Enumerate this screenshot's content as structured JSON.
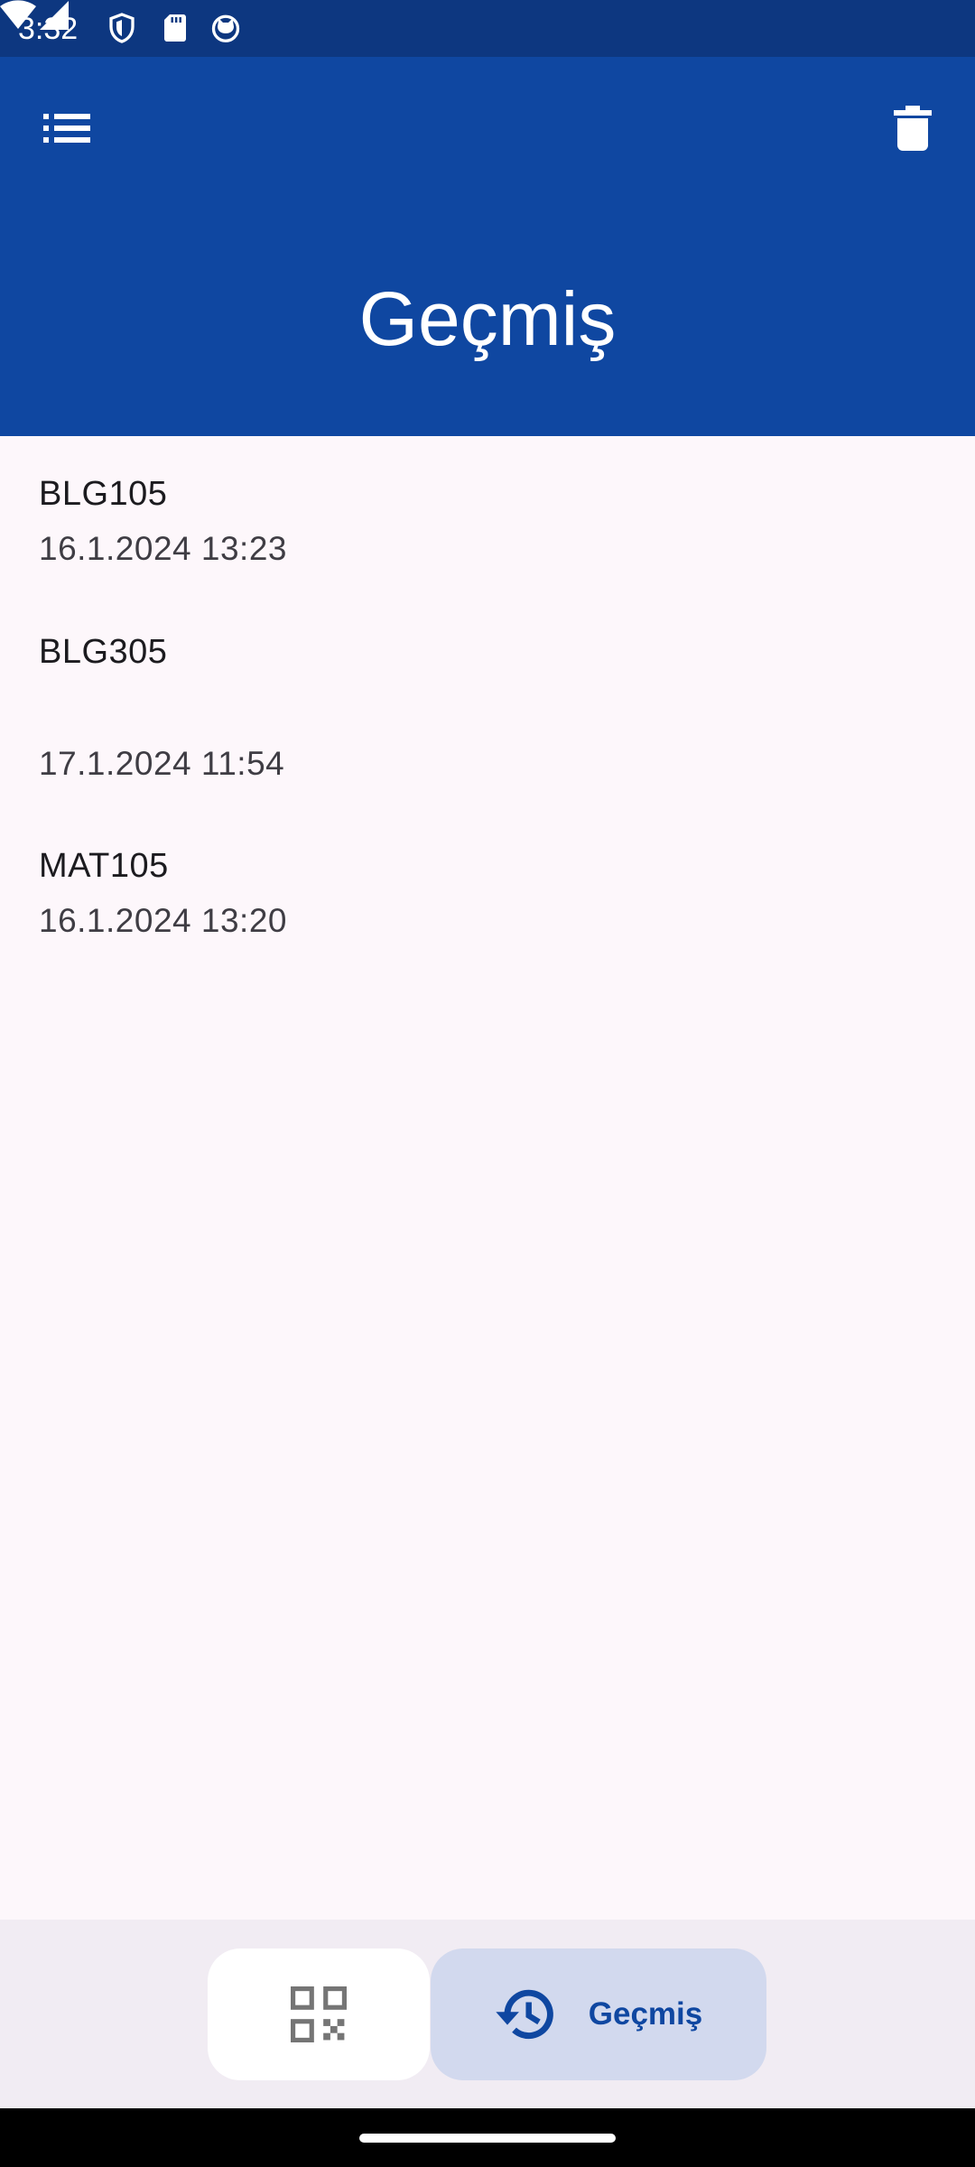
{
  "status_bar": {
    "time": "3:32",
    "icons": [
      "shield-icon",
      "sd-card-icon",
      "cat-icon",
      "wifi-icon",
      "signal-icon"
    ]
  },
  "app_bar": {
    "title": "Geçmiş",
    "menu_icon": "list-icon",
    "delete_icon": "trash-icon",
    "background_color": "#0f47a1"
  },
  "history": {
    "items": [
      {
        "code": "BLG105",
        "date": "16.1.2024 13:23"
      },
      {
        "code": "BLG305",
        "date": "17.1.2024 11:54"
      },
      {
        "code": "MAT105",
        "date": "16.1.2024 13:20"
      }
    ]
  },
  "bottom_nav": {
    "scan_icon": "qr-code-icon",
    "history_icon": "history-icon",
    "history_label": "Geçmiş",
    "selected": "history",
    "selected_color": "#d2d9ee"
  }
}
